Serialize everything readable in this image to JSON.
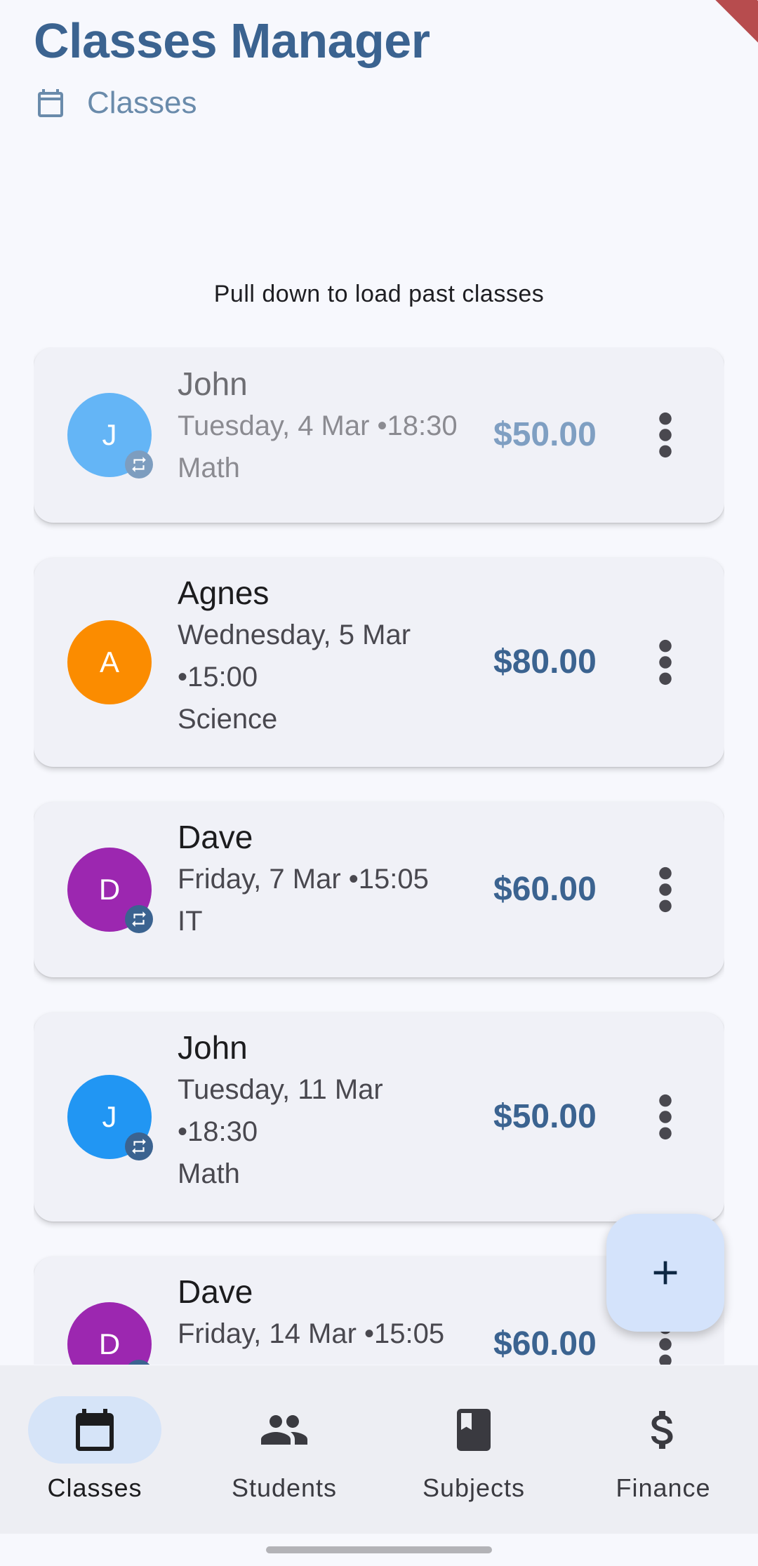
{
  "header": {
    "title": "Classes Manager",
    "subtitle": "Classes",
    "subtitle_icon": "calendar-icon"
  },
  "list": {
    "pull_hint": "Pull down to load past classes",
    "classes": [
      {
        "name": "John",
        "initial": "J",
        "avatar_color": "#64b5f6",
        "date_line1": "Tuesday, 4 Mar •18:30",
        "date_line2": "",
        "subject": "Math",
        "price": "$50.00",
        "recurring": true,
        "faded": true
      },
      {
        "name": "Agnes",
        "initial": "A",
        "avatar_color": "#fb8c00",
        "date_line1": "Wednesday, 5 Mar",
        "date_line2": "•15:00",
        "subject": "Science",
        "price": "$80.00",
        "recurring": false,
        "faded": false
      },
      {
        "name": "Dave",
        "initial": "D",
        "avatar_color": "#9c27b0",
        "date_line1": "Friday, 7 Mar •15:05",
        "date_line2": "",
        "subject": "IT",
        "price": "$60.00",
        "recurring": true,
        "faded": false
      },
      {
        "name": "John",
        "initial": "J",
        "avatar_color": "#2196f3",
        "date_line1": "Tuesday, 11 Mar",
        "date_line2": "•18:30",
        "subject": "Math",
        "price": "$50.00",
        "recurring": true,
        "faded": false
      },
      {
        "name": "Dave",
        "initial": "D",
        "avatar_color": "#9c27b0",
        "date_line1": "Friday, 14 Mar •15:05",
        "date_line2": "",
        "subject": "",
        "price": "$60.00",
        "recurring": true,
        "faded": false
      }
    ]
  },
  "fab": {
    "icon": "plus-icon"
  },
  "nav": {
    "items": [
      {
        "label": "Classes",
        "icon": "calendar-icon",
        "active": true
      },
      {
        "label": "Students",
        "icon": "people-icon",
        "active": false
      },
      {
        "label": "Subjects",
        "icon": "book-icon",
        "active": false
      },
      {
        "label": "Finance",
        "icon": "dollar-icon",
        "active": false
      }
    ]
  },
  "colors": {
    "primary": "#3b6390",
    "background": "#f7f8fd",
    "card": "#f0f1f7",
    "fab": "#d4e3fb",
    "nav_active_pill": "#d6e4f8"
  }
}
